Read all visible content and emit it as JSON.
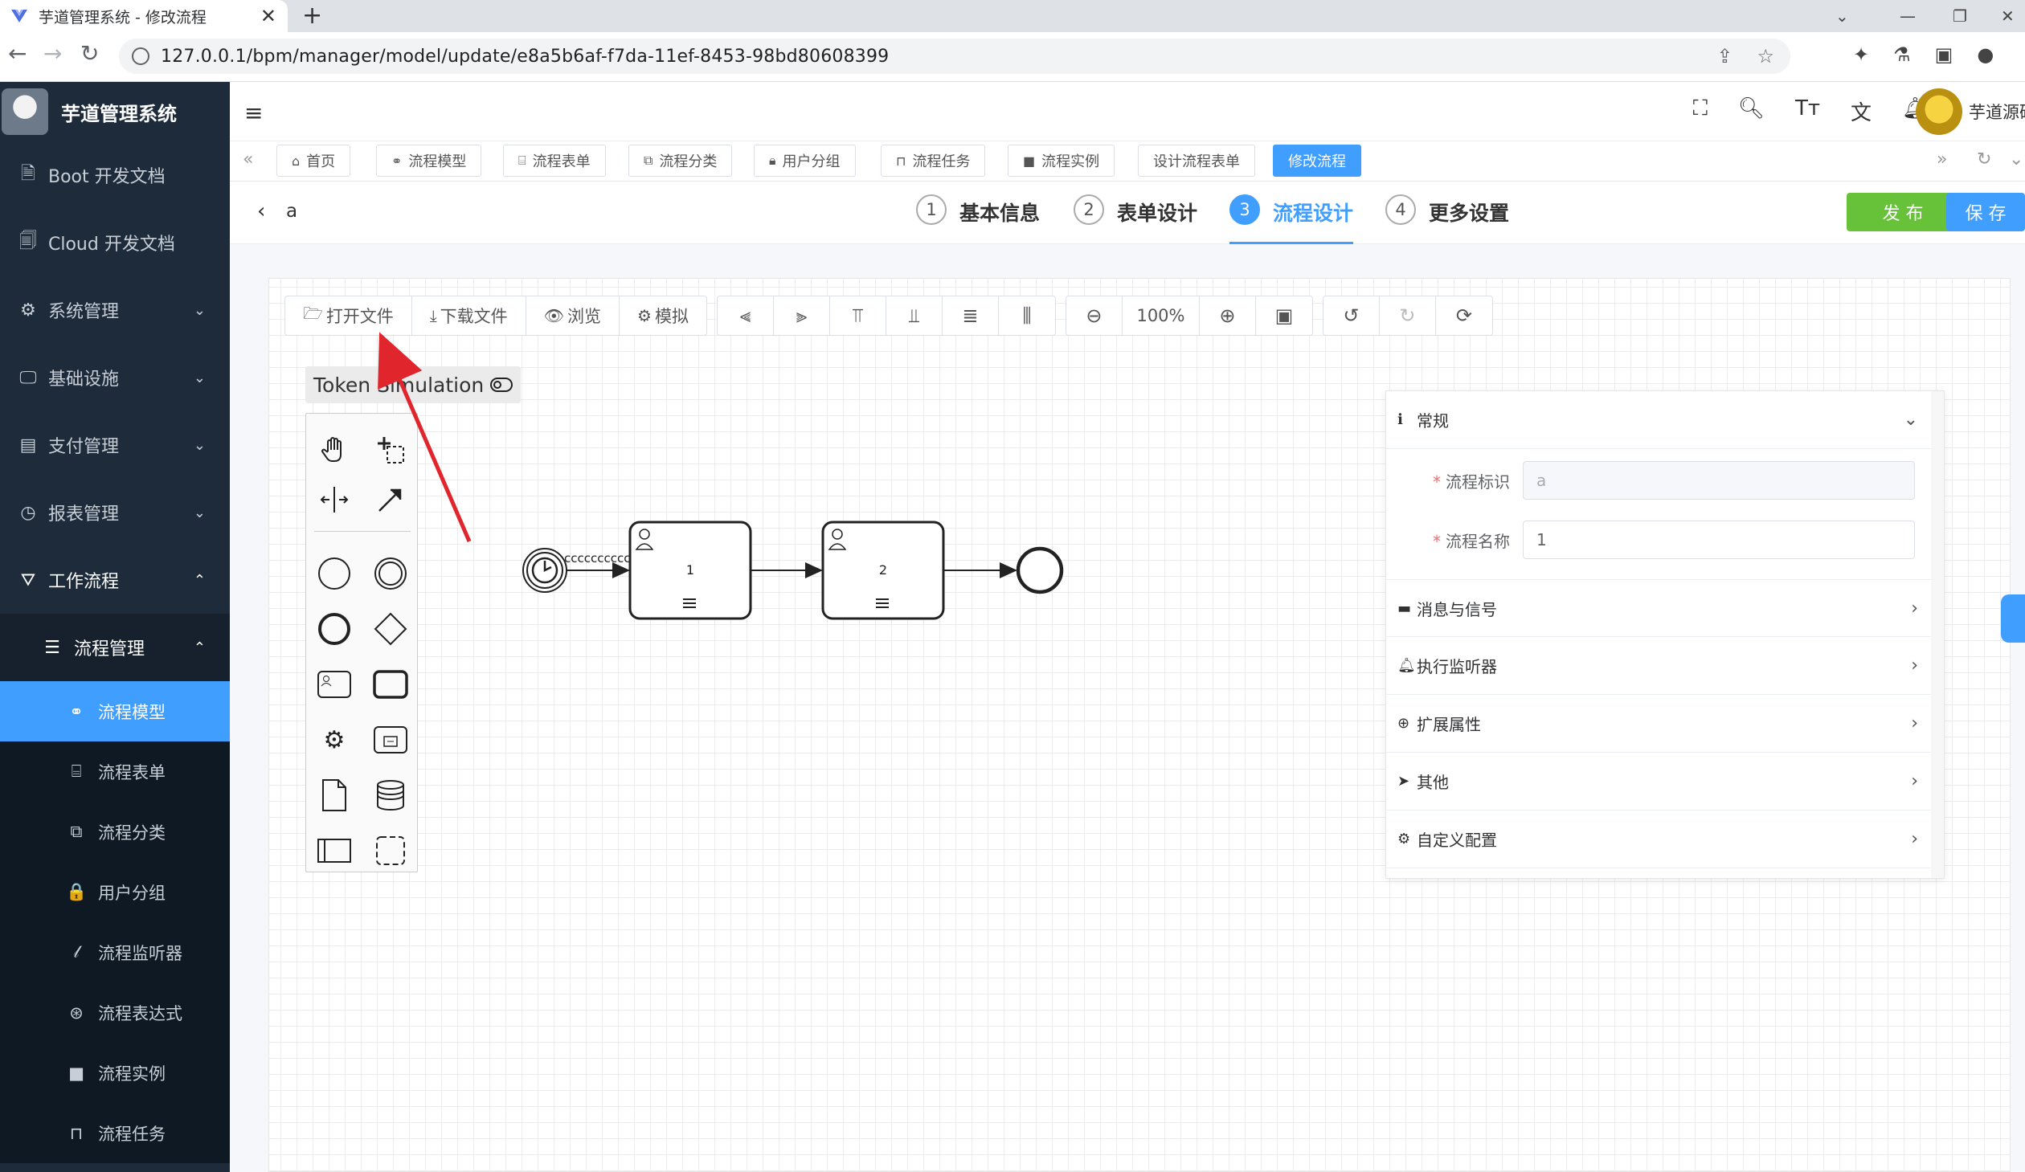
{
  "browser": {
    "tab_title": "芋道管理系统 - 修改流程",
    "url": "127.0.0.1/bpm/manager/model/update/e8a5b6af-f7da-11ef-8453-98bd80608399"
  },
  "sidebar": {
    "brand": "芋道管理系统",
    "items": [
      {
        "label": "Boot 开发文档"
      },
      {
        "label": "Cloud 开发文档"
      },
      {
        "label": "系统管理"
      },
      {
        "label": "基础设施"
      },
      {
        "label": "支付管理"
      },
      {
        "label": "报表管理"
      },
      {
        "label": "工作流程"
      }
    ],
    "submenu_label": "流程管理",
    "subitems": [
      {
        "label": "流程模型"
      },
      {
        "label": "流程表单"
      },
      {
        "label": "流程分类"
      },
      {
        "label": "用户分组"
      },
      {
        "label": "流程监听器"
      },
      {
        "label": "流程表达式"
      },
      {
        "label": "流程实例"
      },
      {
        "label": "流程任务"
      }
    ]
  },
  "header": {
    "username": "芋道源码"
  },
  "tags": [
    {
      "label": "首页"
    },
    {
      "label": "流程模型"
    },
    {
      "label": "流程表单"
    },
    {
      "label": "流程分类"
    },
    {
      "label": "用户分组"
    },
    {
      "label": "流程任务"
    },
    {
      "label": "流程实例"
    },
    {
      "label": "设计流程表单"
    },
    {
      "label": "修改流程"
    }
  ],
  "steps_header": {
    "flow_name": "a",
    "steps": [
      {
        "num": "1",
        "label": "基本信息"
      },
      {
        "num": "2",
        "label": "表单设计"
      },
      {
        "num": "3",
        "label": "流程设计"
      },
      {
        "num": "4",
        "label": "更多设置"
      }
    ],
    "active_step": "3",
    "publish_label": "发 布",
    "save_label": "保 存"
  },
  "toolbar": {
    "open_file": "打开文件",
    "download_file": "下载文件",
    "preview": "浏览",
    "simulate": "模拟",
    "zoom": "100%"
  },
  "token_simulation": "Token Simulation",
  "diagram": {
    "start_label": "cccccccccc",
    "task1": "1",
    "task2": "2"
  },
  "properties": {
    "groups": [
      {
        "label": "常规"
      },
      {
        "label": "消息与信号"
      },
      {
        "label": "执行监听器"
      },
      {
        "label": "扩展属性"
      },
      {
        "label": "其他"
      },
      {
        "label": "自定义配置"
      }
    ],
    "fields": [
      {
        "label": "流程标识",
        "value": "a"
      },
      {
        "label": "流程名称",
        "value": "1"
      }
    ]
  },
  "colors": {
    "primary": "#409eff",
    "publish": "#67c23a",
    "sidebar_bg": "#1d2b3a",
    "annotation_arrow": "#e0262c"
  }
}
